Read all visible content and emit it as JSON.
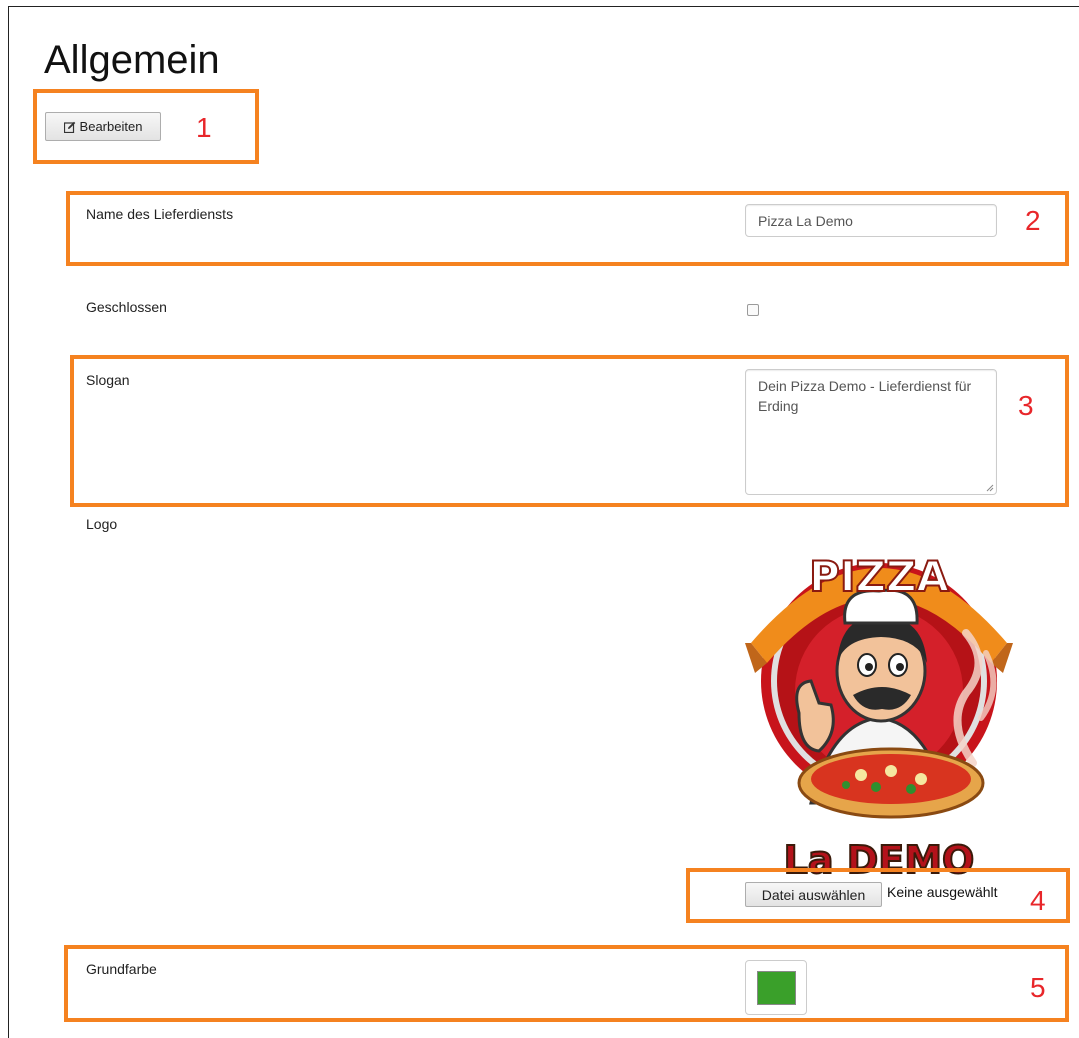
{
  "page": {
    "title": "Allgemein"
  },
  "toolbar": {
    "edit_label": "Bearbeiten",
    "edit_icon": "edit-icon"
  },
  "form": {
    "name_label": "Name des Lieferdiensts",
    "name_value": "Pizza La Demo",
    "closed_label": "Geschlossen",
    "closed_checked": false,
    "slogan_label": "Slogan",
    "slogan_value": "Dein Pizza Demo - Lieferdienst für Erding",
    "logo_label": "Logo",
    "logo_text_top": "PIZZA",
    "logo_text_bottom": "La DEMO",
    "file_button": "Datei auswählen",
    "file_status": "Keine ausgewählt",
    "color_label": "Grundfarbe",
    "color_value": "#3aa02a"
  },
  "annotations": {
    "color": "#f58220",
    "number_color": "#e8262a",
    "labels": [
      "1",
      "2",
      "3",
      "4",
      "5"
    ]
  }
}
